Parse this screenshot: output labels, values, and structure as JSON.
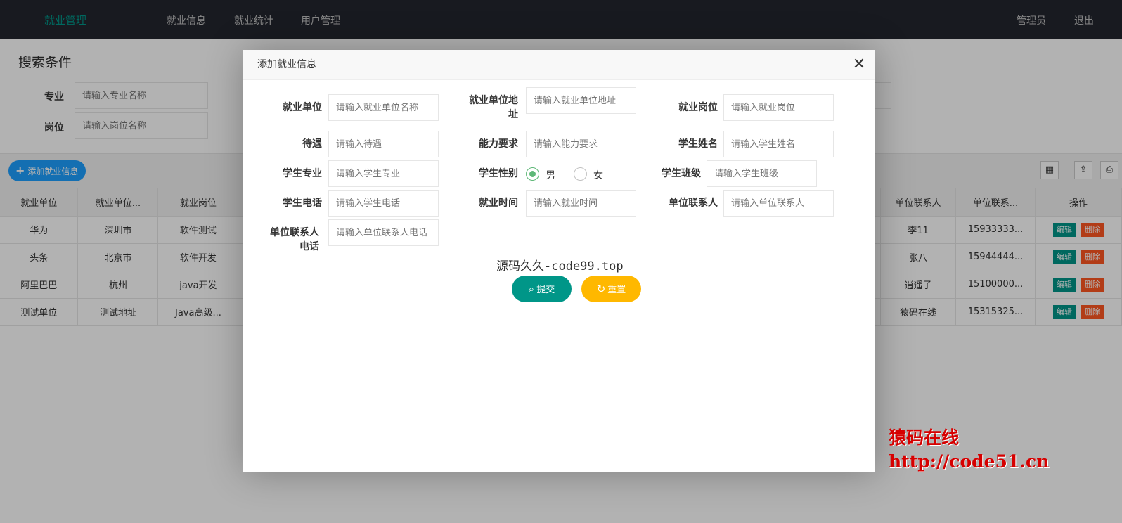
{
  "topnav": {
    "logo": "就业管理",
    "links": [
      "就业信息",
      "就业统计",
      "用户管理"
    ],
    "user": "管理员",
    "logout": "退出"
  },
  "search": {
    "title": "搜索条件",
    "major_label": "专业",
    "major_placeholder": "请输入专业名称",
    "position_label": "岗位",
    "position_placeholder": "请输入岗位名称"
  },
  "toolbar": {
    "add_label": "添加就业信息"
  },
  "table": {
    "headers": [
      "就业单位",
      "就业单位...",
      "就业岗位",
      "单位联系人",
      "单位联系...",
      "操作"
    ],
    "rows": [
      [
        "华为",
        "深圳市",
        "软件测试",
        "李11",
        "15933333..."
      ],
      [
        "头条",
        "北京市",
        "软件开发",
        "张八",
        "15944444..."
      ],
      [
        "阿里巴巴",
        "杭州",
        "java开发",
        "逍遥子",
        "15100000..."
      ],
      [
        "测试单位",
        "测试地址",
        "Java高级...",
        "猿码在线",
        "15315325..."
      ]
    ],
    "edit_label": "编辑",
    "delete_label": "删除"
  },
  "dialog": {
    "title": "添加就业信息",
    "fields": {
      "company": {
        "label": "就业单位",
        "placeholder": "请输入就业单位名称"
      },
      "address": {
        "label": "就业单位地址",
        "placeholder": "请输入就业单位地址"
      },
      "post": {
        "label": "就业岗位",
        "placeholder": "请输入就业岗位"
      },
      "salary": {
        "label": "待遇",
        "placeholder": "请输入待遇"
      },
      "ability": {
        "label": "能力要求",
        "placeholder": "请输入能力要求"
      },
      "student_name": {
        "label": "学生姓名",
        "placeholder": "请输入学生姓名"
      },
      "student_major": {
        "label": "学生专业",
        "placeholder": "请输入学生专业"
      },
      "gender": {
        "label": "学生性别",
        "options": [
          "男",
          "女"
        ],
        "selected": "男"
      },
      "student_class": {
        "label": "学生班级",
        "placeholder": "请输入学生班级"
      },
      "student_phone": {
        "label": "学生电话",
        "placeholder": "请输入学生电话"
      },
      "employ_time": {
        "label": "就业时间",
        "placeholder": "请输入就业时间"
      },
      "contact": {
        "label": "单位联系人",
        "placeholder": "请输入单位联系人"
      },
      "contact_phone": {
        "label": "单位联系人电话",
        "placeholder": "请输入单位联系人电话"
      }
    },
    "watermark": "源码久久-code99.top",
    "submit_label": "提交",
    "reset_label": "重置"
  },
  "overlay_watermark": {
    "line1": "猿码在线",
    "line2": "http://code51.cn"
  },
  "colors": {
    "nav_bg": "#23262e",
    "logo": "#009688",
    "primary": "#009688",
    "blue": "#1e9fff",
    "warm": "#ffb800",
    "danger": "#ff5722",
    "radio": "#5FB878"
  }
}
